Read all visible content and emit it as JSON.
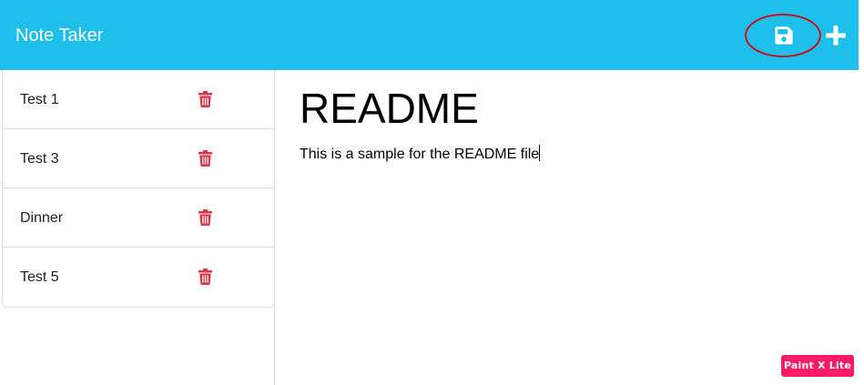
{
  "header": {
    "brand": "Note Taker",
    "save_icon": "floppy-disk-icon",
    "add_icon": "plus-icon",
    "background_color": "#1ebfea"
  },
  "sidebar": {
    "notes": [
      {
        "title": "Test 1",
        "delete_icon": "trash-icon"
      },
      {
        "title": "Test 3",
        "delete_icon": "trash-icon"
      },
      {
        "title": "Dinner",
        "delete_icon": "trash-icon"
      },
      {
        "title": "Test 5",
        "delete_icon": "trash-icon"
      }
    ],
    "delete_icon_color": "#dc3545"
  },
  "editor": {
    "title": "README",
    "body": "This is a sample for the README file"
  },
  "annotation": {
    "ring_color": "#c8101e"
  },
  "watermark": {
    "text": "Paint X Lite",
    "color": "#ff1a66"
  }
}
